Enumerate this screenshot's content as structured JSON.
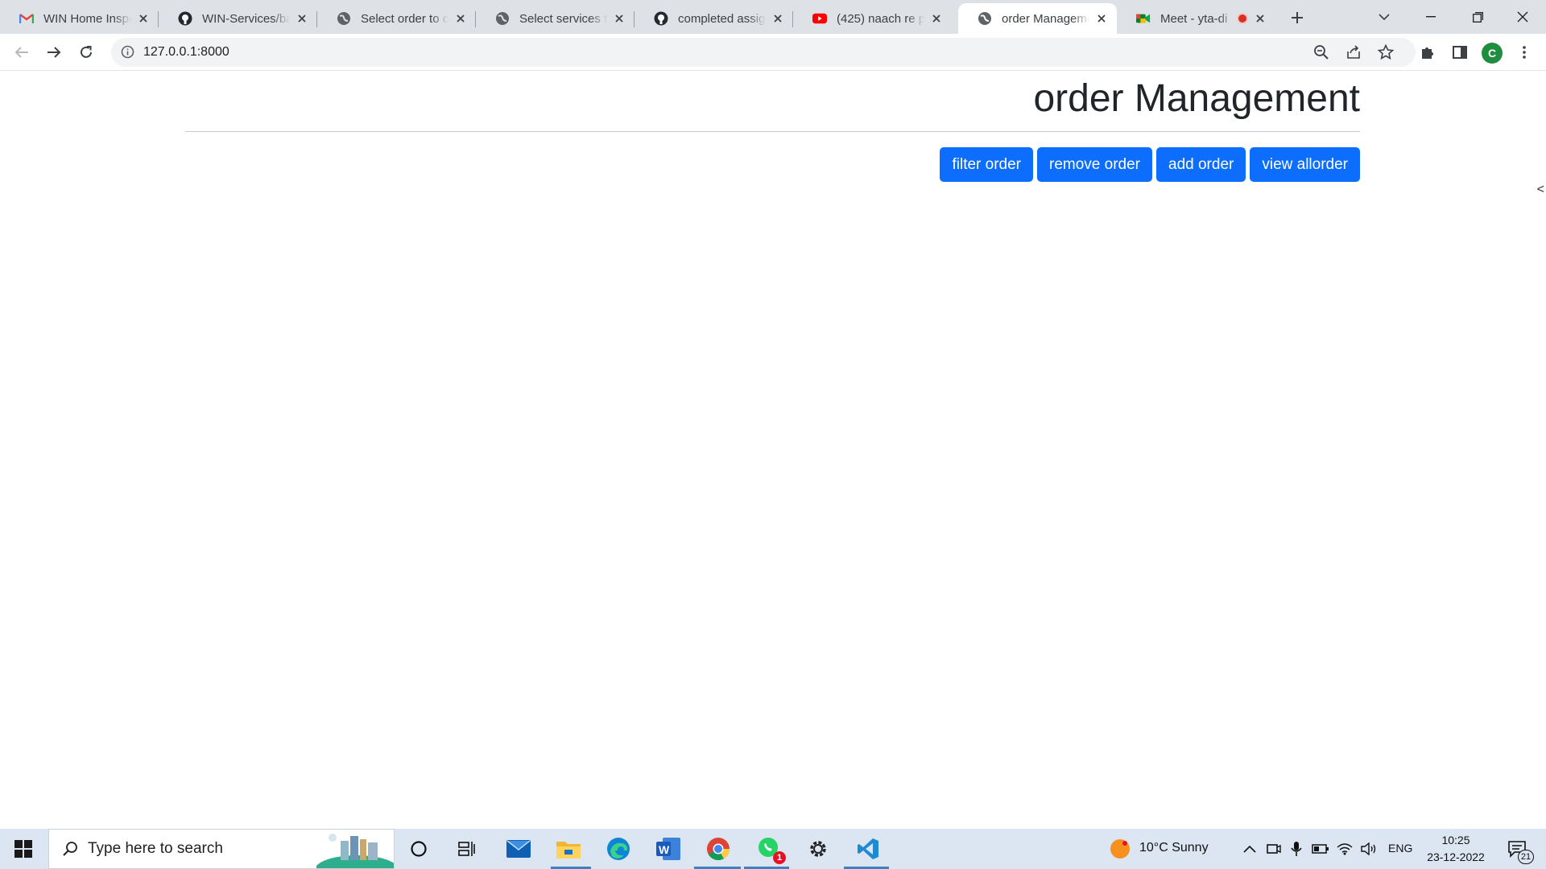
{
  "browser": {
    "tabs": [
      {
        "title": "WIN Home Inspe",
        "icon": "gmail-icon"
      },
      {
        "title": "WIN-Services/bac",
        "icon": "github-icon"
      },
      {
        "title": "Select order to ch",
        "icon": "globe-icon"
      },
      {
        "title": "Select services to",
        "icon": "globe-icon"
      },
      {
        "title": "completed assign",
        "icon": "github-icon"
      },
      {
        "title": "(425) naach re pa",
        "icon": "youtube-icon"
      },
      {
        "title": "order Manageme",
        "icon": "globe-icon",
        "active": true
      },
      {
        "title": "Meet - yta-di",
        "icon": "meet-icon",
        "recording": true
      }
    ],
    "address": "127.0.0.1:8000",
    "profile_initial": "C"
  },
  "page": {
    "title": "order Management",
    "buttons": {
      "filter": "filter order",
      "remove": "remove order",
      "add": "add order",
      "view_all": "view allorder"
    },
    "side_toggle": "<"
  },
  "taskbar": {
    "search_placeholder": "Type here to search",
    "weather": "10°C  Sunny",
    "language": "ENG",
    "time": "10:25",
    "date": "23-12-2022",
    "notifications": "21",
    "whatsapp_badge": "1"
  },
  "colors": {
    "primary_button": "#0d6efd",
    "tab_strip": "#dee1e6",
    "taskbar": "#dbe6f2"
  }
}
